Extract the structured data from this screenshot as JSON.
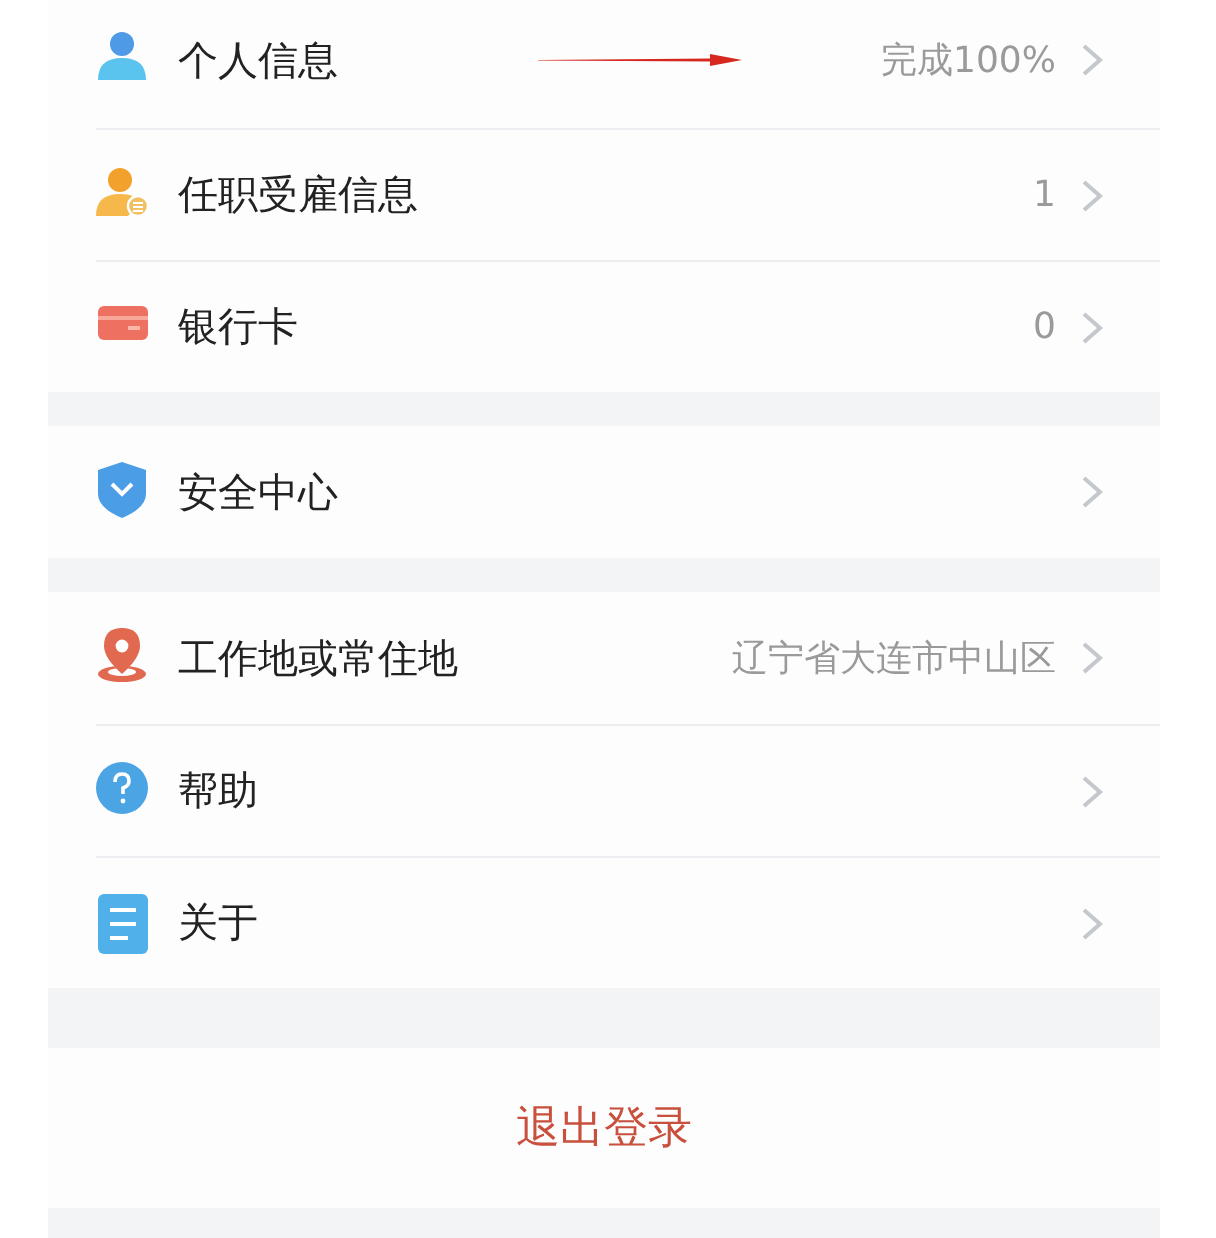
{
  "groups": [
    {
      "rows": [
        {
          "kind": "person",
          "label": "个人信息",
          "value": "完成100%",
          "annotated": true
        },
        {
          "kind": "employment",
          "label": "任职受雇信息",
          "value": "1"
        },
        {
          "kind": "card",
          "label": "银行卡",
          "value": "0"
        }
      ]
    },
    {
      "rows": [
        {
          "kind": "security",
          "label": "安全中心"
        }
      ]
    },
    {
      "rows": [
        {
          "kind": "location",
          "label": "工作地或常住地",
          "value": "辽宁省大连市中山区"
        },
        {
          "kind": "help",
          "label": "帮助"
        },
        {
          "kind": "about",
          "label": "关于"
        }
      ]
    }
  ],
  "logout": {
    "label": "退出登录"
  }
}
